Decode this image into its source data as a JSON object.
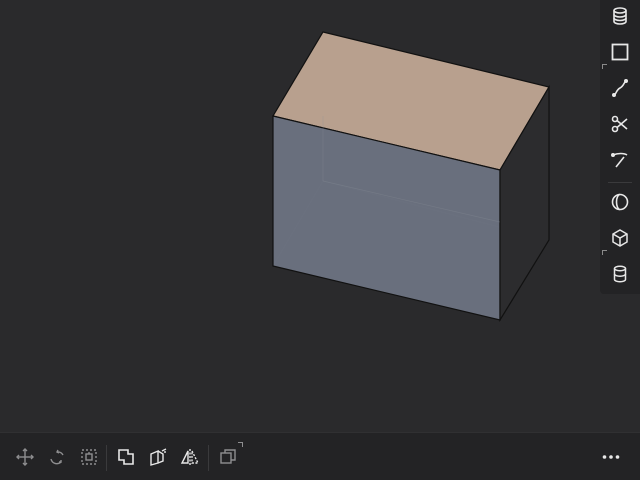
{
  "app": {
    "colors": {
      "background": "#2a2a2c",
      "toolbar": "#232325",
      "icon_active": "#e8e8e8",
      "icon_inactive": "#8e8e90",
      "box_top": "#b8a08e",
      "box_front": "#6b7280",
      "box_side": "#2c2c2e",
      "edge": "#111111"
    }
  },
  "right_toolbar": {
    "items": [
      {
        "icon": "layers-stack-icon"
      },
      {
        "icon": "rectangle-icon"
      },
      {
        "icon": "spline-curve-icon"
      },
      {
        "icon": "scissors-icon"
      },
      {
        "icon": "pen-curve-icon"
      },
      {
        "icon": "ellipse-icon"
      },
      {
        "icon": "cube-icon"
      },
      {
        "icon": "cylinder-icon"
      }
    ]
  },
  "bottom_toolbar": {
    "items": [
      {
        "icon": "move-icon",
        "enabled": false
      },
      {
        "icon": "rotate-icon",
        "enabled": false
      },
      {
        "icon": "scale-icon",
        "enabled": false
      },
      {
        "icon": "boolean-union-icon",
        "enabled": true
      },
      {
        "icon": "extrude-face-icon",
        "enabled": true
      },
      {
        "icon": "mirror-icon",
        "enabled": true
      },
      {
        "icon": "duplicate-icon",
        "enabled": false
      },
      {
        "icon": "more-options-icon",
        "enabled": true
      }
    ]
  }
}
